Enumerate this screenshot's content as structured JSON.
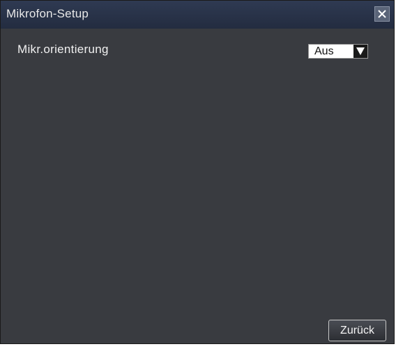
{
  "dialog": {
    "title": "Mikrofon-Setup",
    "close_icon": "close-icon"
  },
  "settings": {
    "mic_orientation_label": "Mikr.orientierung",
    "mic_orientation_value": "Aus",
    "dropdown_icon": "triangle-down-icon"
  },
  "footer": {
    "back_label": "Zurück"
  },
  "colors": {
    "panel_bg": "#393b40",
    "titlebar_bg": "#2a3349",
    "text": "#f0f0f0"
  }
}
